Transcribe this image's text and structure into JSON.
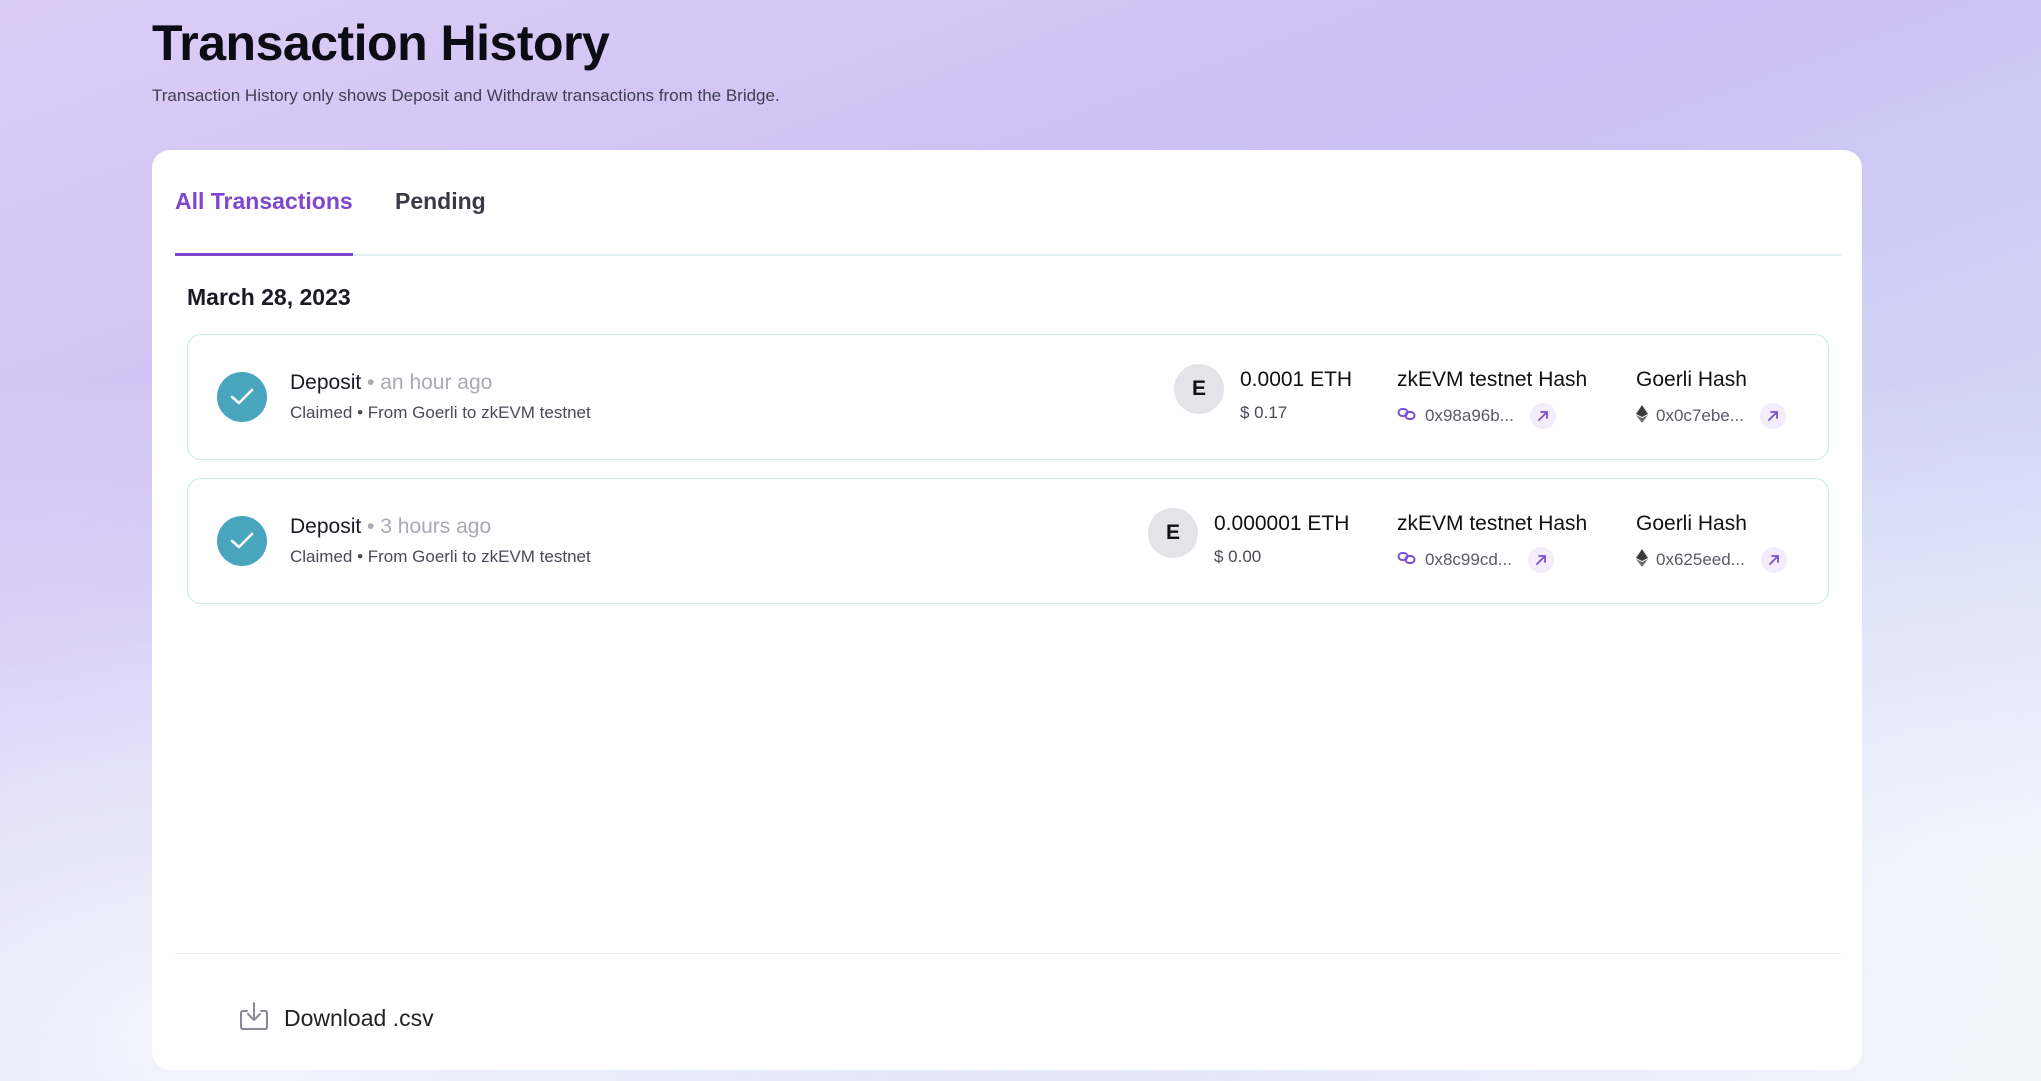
{
  "header": {
    "title": "Transaction History",
    "subtitle": "Transaction History only shows Deposit and Withdraw transactions from the Bridge."
  },
  "tabs": [
    {
      "label": "All Transactions",
      "active": true
    },
    {
      "label": "Pending",
      "active": false
    }
  ],
  "groups": [
    {
      "date": "March 28, 2023",
      "transactions": [
        {
          "type": "Deposit",
          "separator": "•",
          "time": "an hour ago",
          "status": "Claimed • From Goerli to zkEVM testnet",
          "token_initial": "E",
          "amount": "0.0001 ETH",
          "fiat": "$ 0.17",
          "l2_hash_label": "zkEVM testnet Hash",
          "l2_hash": "0x98a96b...",
          "l1_hash_label": "Goerli Hash",
          "l1_hash": "0x0c7ebe..."
        },
        {
          "type": "Deposit",
          "separator": "•",
          "time": "3 hours ago",
          "status": "Claimed • From Goerli to zkEVM testnet",
          "token_initial": "E",
          "amount": "0.000001 ETH",
          "fiat": "$ 0.00",
          "l2_hash_label": "zkEVM testnet Hash",
          "l2_hash": "0x8c99cd...",
          "l1_hash_label": "Goerli Hash",
          "l1_hash": "0x625eed..."
        }
      ]
    }
  ],
  "footer": {
    "download_label": "Download .csv"
  },
  "colors": {
    "accent": "#8046cf",
    "success": "#49a5bd",
    "row_border": "#c6e7e3"
  },
  "icons": {
    "status": "check-circle-icon",
    "l2_chain": "chain-link-icon",
    "l1_chain": "ethereum-icon",
    "external": "arrow-up-right-icon",
    "download": "download-icon"
  }
}
